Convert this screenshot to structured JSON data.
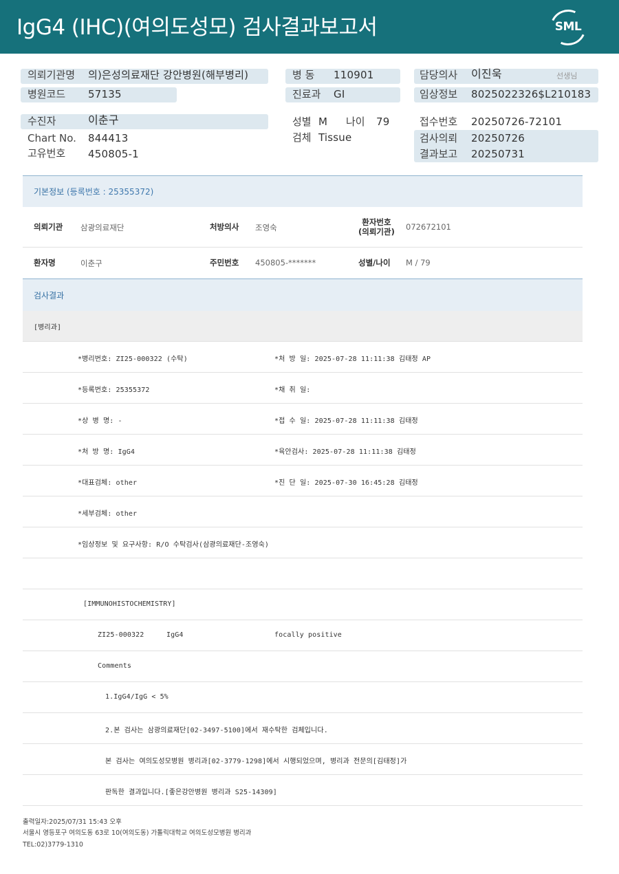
{
  "header": {
    "title": "IgG4 (IHC)(여의도성모) 검사결과보고서",
    "logo_text": "SML"
  },
  "info": {
    "requesting_institution_label": "의뢰기관명",
    "requesting_institution_value": "의)은성의료재단 강안병원(해부병리)",
    "hospital_code_label": "병원코드",
    "hospital_code_value": "57135",
    "ward_label": "병 동",
    "ward_value": "110901",
    "department_label": "진료과",
    "department_value": "GI",
    "physician_label": "담당의사",
    "physician_value": "이진욱",
    "physician_honorific": "선생님",
    "clinical_info_label": "임상정보",
    "clinical_info_value": "8025022326$L210183",
    "patient_label": "수진자",
    "patient_value": "이춘구",
    "chart_label": "Chart No.",
    "chart_value": "844413",
    "unique_id_label": "고유번호",
    "unique_id_value": "450805-1",
    "sex_label": "성별",
    "sex_value": "M",
    "age_label": "나이",
    "age_value": "79",
    "specimen_label": "검체",
    "specimen_value": "Tissue",
    "receipt_no_label": "접수번호",
    "receipt_no_value": "20250726-72101",
    "request_date_label": "검사의뢰",
    "request_date_value": "20250726",
    "report_date_label": "결과보고",
    "report_date_value": "20250731"
  },
  "basic_info": {
    "section_title": "기본정보",
    "registration_text": "(등록번호 : 25355372)",
    "institution_label": "의뢰기관",
    "institution_value": "삼광의료재단",
    "prescriber_label": "처방의사",
    "prescriber_value": "조영숙",
    "patient_no_label_1": "환자번호",
    "patient_no_label_2": "(의뢰기관)",
    "patient_no_value": "072672101",
    "patient_name_label": "환자명",
    "patient_name_value": "이춘구",
    "resident_no_label": "주민번호",
    "resident_no_value": "450805-*******",
    "sex_age_label": "성별/나이",
    "sex_age_value": "M / 79"
  },
  "results": {
    "section_title": "검사결과",
    "dept": "[병리과]",
    "lines": [
      {
        "left": "*병리번호: ZI25-000322 (수탁)",
        "right": "*처 방 일: 2025-07-28 11:11:38  김태정 AP"
      },
      {
        "left": "*등록번호: 25355372",
        "right": "*채 취 일:"
      },
      {
        "left": "*상 병 명: -",
        "right": "*접 수 일: 2025-07-28 11:11:38  김태정"
      },
      {
        "left": "*처 방 명: IgG4",
        "right": "*육안검사: 2025-07-28 11:11:38  김태정"
      },
      {
        "left": "*대표검체: other",
        "right": "*진 단 일: 2025-07-30 16:45:28  김태정"
      },
      {
        "left": "*세부검체: other",
        "right": ""
      },
      {
        "left": "*임상정보 및 요구사항: R/O 수탁검사(삼광의료재단-조영숙)",
        "right": ""
      }
    ],
    "ihc_header": "[IMMUNOHISTOCHEMISTRY]",
    "ihc_case": "ZI25-000322",
    "ihc_marker": "IgG4",
    "ihc_result": "focally positive",
    "comments_label": "Comments",
    "comment_lines": [
      "1.IgG4/IgG < 5%",
      "2.본 검사는 삼광의료재단[02-3497-5100]에서 재수탁한 검체입니다.",
      "본 검사는 여의도성모병원 병리과[02-3779-1298]에서 시행되었으며, 병리과 전문의[김태정]가",
      "판독한 결과입니다.[좋은강안병원 병리과 S25-14309]"
    ]
  },
  "footer": {
    "print_date": "출력일자:2025/07/31 15:43 오후",
    "address": "서울시 영등포구 여의도동 63로 10(여의도동) 가톨릭대학교 여의도성모병원 병리과",
    "tel": "TEL:02)3779-1310"
  },
  "colors": {
    "header_bg": "#16717b",
    "pill_bg": "#dde8ef",
    "section_bg": "#e6eef5",
    "section_title": "#3570a3"
  }
}
